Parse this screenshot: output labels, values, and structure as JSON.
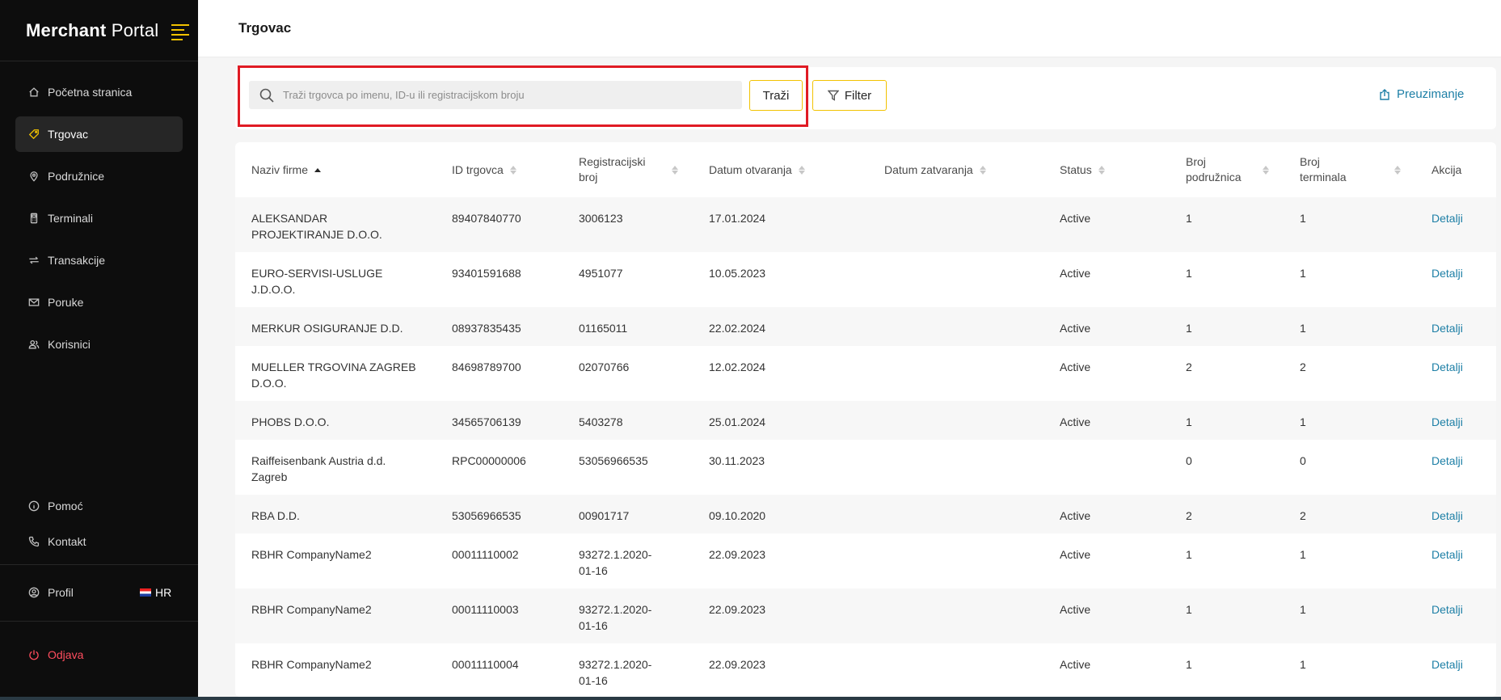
{
  "brand": {
    "bold": "Merchant",
    "rest": "Portal"
  },
  "sidebar": {
    "items": [
      {
        "label": "Početna stranica",
        "icon": "home-icon"
      },
      {
        "label": "Trgovac",
        "icon": "tag-icon",
        "active": true
      },
      {
        "label": "Podružnice",
        "icon": "location-pin-icon"
      },
      {
        "label": "Terminali",
        "icon": "pos-terminal-icon"
      },
      {
        "label": "Transakcije",
        "icon": "transfer-arrows-icon"
      },
      {
        "label": "Poruke",
        "icon": "mail-icon"
      },
      {
        "label": "Korisnici",
        "icon": "users-icon"
      }
    ],
    "help": "Pomoć",
    "contact": "Kontakt",
    "profile": "Profil",
    "language": "HR",
    "logout": "Odjava"
  },
  "header": {
    "title": "Trgovac"
  },
  "toolbar": {
    "search_placeholder": "Traži trgovca po imenu, ID-u ili registracijskom broju",
    "search_button": "Traži",
    "filter_button": "Filter",
    "download": "Preuzimanje"
  },
  "table": {
    "columns": [
      "Naziv firme",
      "ID trgovca",
      "Registracijski broj",
      "Datum otvaranja",
      "Datum zatvaranja",
      "Status",
      "Broj podružnica",
      "Broj terminala",
      "Akcija"
    ],
    "rows": [
      {
        "name": "ALEKSANDAR PROJEKTIRANJE D.O.O.",
        "id": "89407840770",
        "reg": "3006123",
        "opened": "17.01.2024",
        "closed": "",
        "status": "Active",
        "branches": "1",
        "terminals": "1",
        "action": "Detalji"
      },
      {
        "name": "EURO-SERVISI-USLUGE J.D.O.O.",
        "id": "93401591688",
        "reg": "4951077",
        "opened": "10.05.2023",
        "closed": "",
        "status": "Active",
        "branches": "1",
        "terminals": "1",
        "action": "Detalji"
      },
      {
        "name": "MERKUR OSIGURANJE D.D.",
        "id": "08937835435",
        "reg": "01165011",
        "opened": "22.02.2024",
        "closed": "",
        "status": "Active",
        "branches": "1",
        "terminals": "1",
        "action": "Detalji"
      },
      {
        "name": "MUELLER TRGOVINA ZAGREB D.O.O.",
        "id": "84698789700",
        "reg": "02070766",
        "opened": "12.02.2024",
        "closed": "",
        "status": "Active",
        "branches": "2",
        "terminals": "2",
        "action": "Detalji"
      },
      {
        "name": "PHOBS D.O.O.",
        "id": "34565706139",
        "reg": "5403278",
        "opened": "25.01.2024",
        "closed": "",
        "status": "Active",
        "branches": "1",
        "terminals": "1",
        "action": "Detalji"
      },
      {
        "name": "Raiffeisenbank Austria d.d. Zagreb",
        "id": "RPC00000006",
        "reg": "53056966535",
        "opened": "30.11.2023",
        "closed": "",
        "status": "",
        "branches": "0",
        "terminals": "0",
        "action": "Detalji"
      },
      {
        "name": "RBA D.D.",
        "id": "53056966535",
        "reg": "00901717",
        "opened": "09.10.2020",
        "closed": "",
        "status": "Active",
        "branches": "2",
        "terminals": "2",
        "action": "Detalji"
      },
      {
        "name": "RBHR CompanyName2",
        "id": "00011110002",
        "reg": "93272.1.2020-01-16",
        "opened": "22.09.2023",
        "closed": "",
        "status": "Active",
        "branches": "1",
        "terminals": "1",
        "action": "Detalji"
      },
      {
        "name": "RBHR CompanyName2",
        "id": "00011110003",
        "reg": "93272.1.2020-01-16",
        "opened": "22.09.2023",
        "closed": "",
        "status": "Active",
        "branches": "1",
        "terminals": "1",
        "action": "Detalji"
      },
      {
        "name": "RBHR CompanyName2",
        "id": "00011110004",
        "reg": "93272.1.2020-01-16",
        "opened": "22.09.2023",
        "closed": "",
        "status": "Active",
        "branches": "1",
        "terminals": "1",
        "action": "Detalji"
      }
    ]
  },
  "colors": {
    "accent": "#f2c200",
    "link": "#1d7fa6",
    "danger": "#ff4d5e",
    "highlight": "#e01b24",
    "sidebar_bg": "#0d0d0d"
  }
}
